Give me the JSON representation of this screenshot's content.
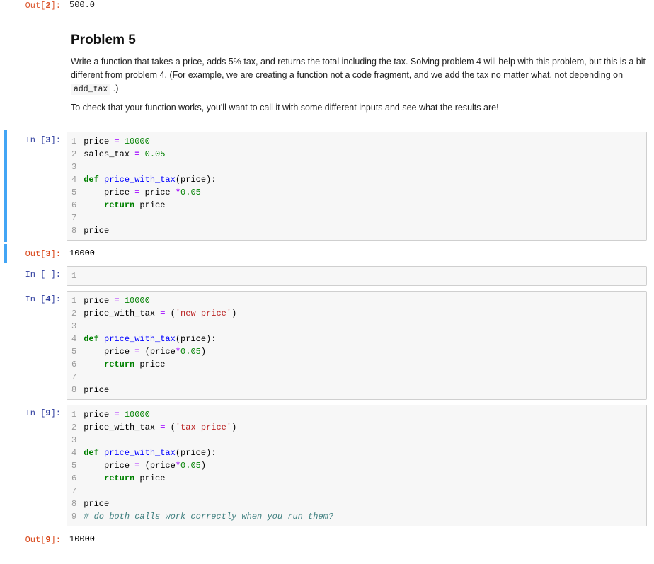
{
  "top_out": {
    "prompt_prefix": "Out[",
    "prompt_num": "2",
    "prompt_suffix": "]:",
    "value": "500.0"
  },
  "problem": {
    "heading": "Problem 5",
    "p1_a": "Write a function that takes a price, adds 5% tax, and returns the total including the tax. Solving problem 4 will help with this problem, but this is a bit different from problem 4. (For example, we are creating a function not a code fragment, and we add the tax no matter what, not depending on ",
    "p1_code": "add_tax",
    "p1_b": " .)",
    "p2": "To check that your function works, you'll want to call it with some different inputs and see what the results are!"
  },
  "cells": {
    "c3": {
      "in_prefix": "In [",
      "in_num": "3",
      "in_suffix": "]:",
      "out_prefix": "Out[",
      "out_num": "3",
      "out_suffix": "]:",
      "out_value": "10000",
      "lines": [
        [
          {
            "t": "price ",
            "c": ""
          },
          {
            "t": "=",
            "c": "op"
          },
          {
            "t": " ",
            "c": ""
          },
          {
            "t": "10000",
            "c": "num"
          }
        ],
        [
          {
            "t": "sales_tax ",
            "c": ""
          },
          {
            "t": "=",
            "c": "op"
          },
          {
            "t": " ",
            "c": ""
          },
          {
            "t": "0.05",
            "c": "num"
          }
        ],
        [
          {
            "t": "",
            "c": ""
          }
        ],
        [
          {
            "t": "def",
            "c": "kw"
          },
          {
            "t": " ",
            "c": ""
          },
          {
            "t": "price_with_tax",
            "c": "fn"
          },
          {
            "t": "(price):",
            "c": ""
          }
        ],
        [
          {
            "t": "    price ",
            "c": ""
          },
          {
            "t": "=",
            "c": "op"
          },
          {
            "t": " price ",
            "c": ""
          },
          {
            "t": "*",
            "c": "op"
          },
          {
            "t": "0.05",
            "c": "num"
          }
        ],
        [
          {
            "t": "    ",
            "c": ""
          },
          {
            "t": "return",
            "c": "kw"
          },
          {
            "t": " price",
            "c": ""
          }
        ],
        [
          {
            "t": "",
            "c": ""
          }
        ],
        [
          {
            "t": "price",
            "c": ""
          }
        ]
      ]
    },
    "cEmpty": {
      "in_prefix": "In [",
      "in_num": " ",
      "in_suffix": "]:",
      "lines": [
        [
          {
            "t": "",
            "c": ""
          }
        ]
      ]
    },
    "c4": {
      "in_prefix": "In [",
      "in_num": "4",
      "in_suffix": "]:",
      "lines": [
        [
          {
            "t": "price ",
            "c": ""
          },
          {
            "t": "=",
            "c": "op"
          },
          {
            "t": " ",
            "c": ""
          },
          {
            "t": "10000",
            "c": "num"
          }
        ],
        [
          {
            "t": "price_with_tax ",
            "c": ""
          },
          {
            "t": "=",
            "c": "op"
          },
          {
            "t": " (",
            "c": ""
          },
          {
            "t": "'new price'",
            "c": "str"
          },
          {
            "t": ")",
            "c": ""
          }
        ],
        [
          {
            "t": "",
            "c": ""
          }
        ],
        [
          {
            "t": "def",
            "c": "kw"
          },
          {
            "t": " ",
            "c": ""
          },
          {
            "t": "price_with_tax",
            "c": "fn"
          },
          {
            "t": "(price):",
            "c": ""
          }
        ],
        [
          {
            "t": "    price ",
            "c": ""
          },
          {
            "t": "=",
            "c": "op"
          },
          {
            "t": " (price",
            "c": ""
          },
          {
            "t": "*",
            "c": "op"
          },
          {
            "t": "0.05",
            "c": "num"
          },
          {
            "t": ")",
            "c": ""
          }
        ],
        [
          {
            "t": "    ",
            "c": ""
          },
          {
            "t": "return",
            "c": "kw"
          },
          {
            "t": " price",
            "c": ""
          }
        ],
        [
          {
            "t": "",
            "c": ""
          }
        ],
        [
          {
            "t": "price",
            "c": ""
          }
        ]
      ]
    },
    "c9": {
      "in_prefix": "In [",
      "in_num": "9",
      "in_suffix": "]:",
      "out_prefix": "Out[",
      "out_num": "9",
      "out_suffix": "]:",
      "out_value": "10000",
      "lines": [
        [
          {
            "t": "price ",
            "c": ""
          },
          {
            "t": "=",
            "c": "op"
          },
          {
            "t": " ",
            "c": ""
          },
          {
            "t": "10000",
            "c": "num"
          }
        ],
        [
          {
            "t": "price_with_tax ",
            "c": ""
          },
          {
            "t": "=",
            "c": "op"
          },
          {
            "t": " (",
            "c": ""
          },
          {
            "t": "'tax price'",
            "c": "str"
          },
          {
            "t": ")",
            "c": ""
          }
        ],
        [
          {
            "t": "",
            "c": ""
          }
        ],
        [
          {
            "t": "def",
            "c": "kw"
          },
          {
            "t": " ",
            "c": ""
          },
          {
            "t": "price_with_tax",
            "c": "fn"
          },
          {
            "t": "(price):",
            "c": ""
          }
        ],
        [
          {
            "t": "    price ",
            "c": ""
          },
          {
            "t": "=",
            "c": "op"
          },
          {
            "t": " (price",
            "c": ""
          },
          {
            "t": "*",
            "c": "op"
          },
          {
            "t": "0.05",
            "c": "num"
          },
          {
            "t": ")",
            "c": ""
          }
        ],
        [
          {
            "t": "    ",
            "c": ""
          },
          {
            "t": "return",
            "c": "kw"
          },
          {
            "t": " price",
            "c": ""
          }
        ],
        [
          {
            "t": "",
            "c": ""
          }
        ],
        [
          {
            "t": "price",
            "c": ""
          }
        ],
        [
          {
            "t": "# do both calls work correctly when you run them?",
            "c": "cmt"
          }
        ]
      ]
    }
  }
}
